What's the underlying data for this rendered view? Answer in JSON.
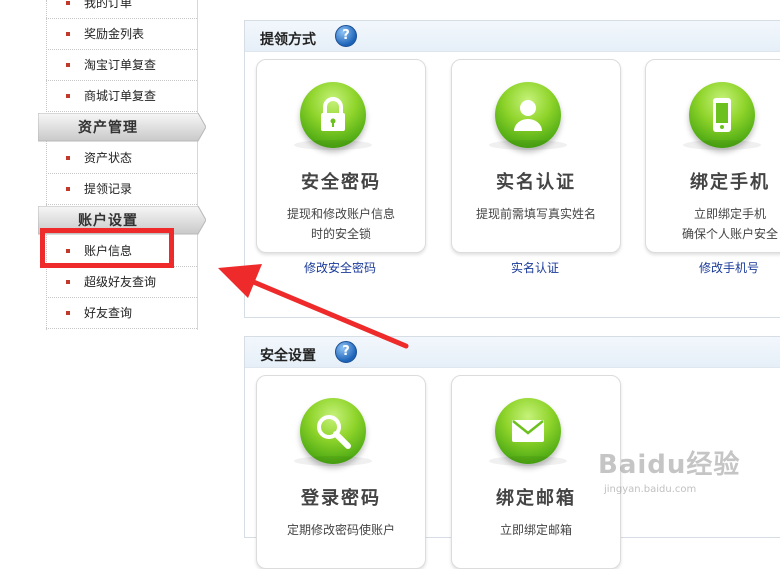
{
  "sidebar": {
    "items_top": [
      {
        "label": "我的订单"
      },
      {
        "label": "奖励金列表"
      },
      {
        "label": "淘宝订单复查"
      },
      {
        "label": "商城订单复查"
      }
    ],
    "section_asset": {
      "title": "资产管理",
      "items": [
        {
          "label": "资产状态"
        },
        {
          "label": "提领记录"
        }
      ]
    },
    "section_account": {
      "title": "账户设置",
      "items": [
        {
          "label": "账户信息"
        },
        {
          "label": "超级好友查询"
        },
        {
          "label": "好友查询"
        }
      ]
    }
  },
  "panel_withdraw": {
    "title": "提领方式",
    "help": "?",
    "cards": [
      {
        "icon": "lock-icon",
        "title": "安全密码",
        "desc1": "提现和修改账户信息",
        "desc2": "时的安全锁",
        "link": "修改安全密码"
      },
      {
        "icon": "user-icon",
        "title": "实名认证",
        "desc1": "提现前需填写真实姓名",
        "desc2": "",
        "link": "实名认证"
      },
      {
        "icon": "phone-icon",
        "title": "绑定手机",
        "desc1": "立即绑定手机",
        "desc2": "确保个人账户安全",
        "link": "修改手机号"
      }
    ]
  },
  "panel_security": {
    "title": "安全设置",
    "help": "?",
    "cards": [
      {
        "icon": "search-icon",
        "title": "登录密码",
        "desc1": "定期修改密码使账户",
        "desc2": ""
      },
      {
        "icon": "mail-icon",
        "title": "绑定邮箱",
        "desc1": "立即绑定邮箱",
        "desc2": ""
      }
    ]
  },
  "watermark": {
    "main": "Baidu经验",
    "sub": "jingyan.baidu.com"
  },
  "colors": {
    "accent_green": "#6cc11f",
    "highlight_red": "#ee2a2a",
    "link_blue": "#1a3a99"
  }
}
